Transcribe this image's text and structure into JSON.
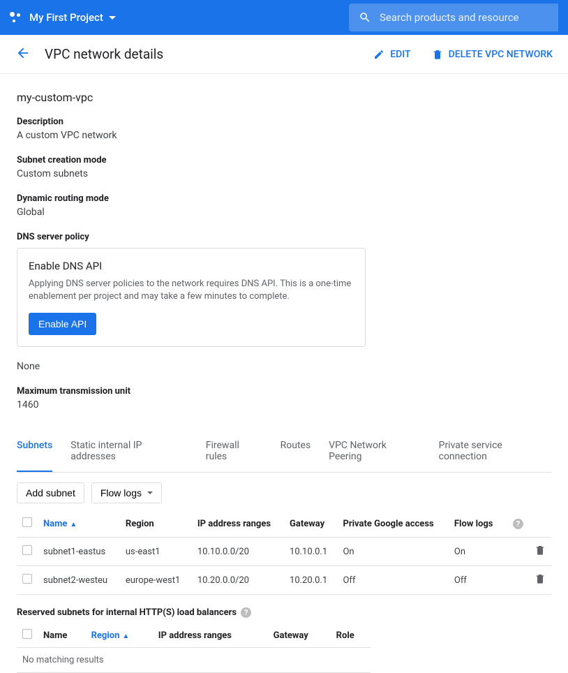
{
  "topbar": {
    "project_name": "My First Project",
    "search_placeholder": "Search products and resource"
  },
  "titlebar": {
    "title": "VPC network details",
    "edit_label": "EDIT",
    "delete_label": "DELETE VPC NETWORK"
  },
  "resource": {
    "name": "my-custom-vpc"
  },
  "fields": {
    "description": {
      "label": "Description",
      "value": "A custom VPC network"
    },
    "subnet_mode": {
      "label": "Subnet creation mode",
      "value": "Custom subnets"
    },
    "routing": {
      "label": "Dynamic routing mode",
      "value": "Global"
    },
    "dns_policy": {
      "label": "DNS server policy"
    },
    "mtu": {
      "label": "Maximum transmission unit",
      "value": "1460"
    }
  },
  "dns_card": {
    "title": "Enable DNS API",
    "body": "Applying DNS server policies to the network requires DNS API. This is a one-time enablement per project and may take a few minutes to complete.",
    "button": "Enable API"
  },
  "dns_policy_value": "None",
  "tabs": [
    "Subnets",
    "Static internal IP addresses",
    "Firewall rules",
    "Routes",
    "VPC Network Peering",
    "Private service connection"
  ],
  "toolbar": {
    "add": "Add subnet",
    "flowlogs": "Flow logs"
  },
  "subnets": {
    "headers": [
      "Name",
      "Region",
      "IP address ranges",
      "Gateway",
      "Private Google access",
      "Flow logs"
    ],
    "rows": [
      {
        "name": "subnet1-eastus",
        "region": "us-east1",
        "range": "10.10.0.0/20",
        "gateway": "10.10.0.1",
        "pga": "On",
        "flow": "On"
      },
      {
        "name": "subnet2-westeu",
        "region": "europe-west1",
        "range": "10.20.0.0/20",
        "gateway": "10.20.0.1",
        "pga": "Off",
        "flow": "Off"
      }
    ]
  },
  "reserved": {
    "title": "Reserved subnets for internal HTTP(S) load balancers",
    "headers": [
      "Name",
      "Region",
      "IP address ranges",
      "Gateway",
      "Role"
    ],
    "empty": "No matching results"
  }
}
